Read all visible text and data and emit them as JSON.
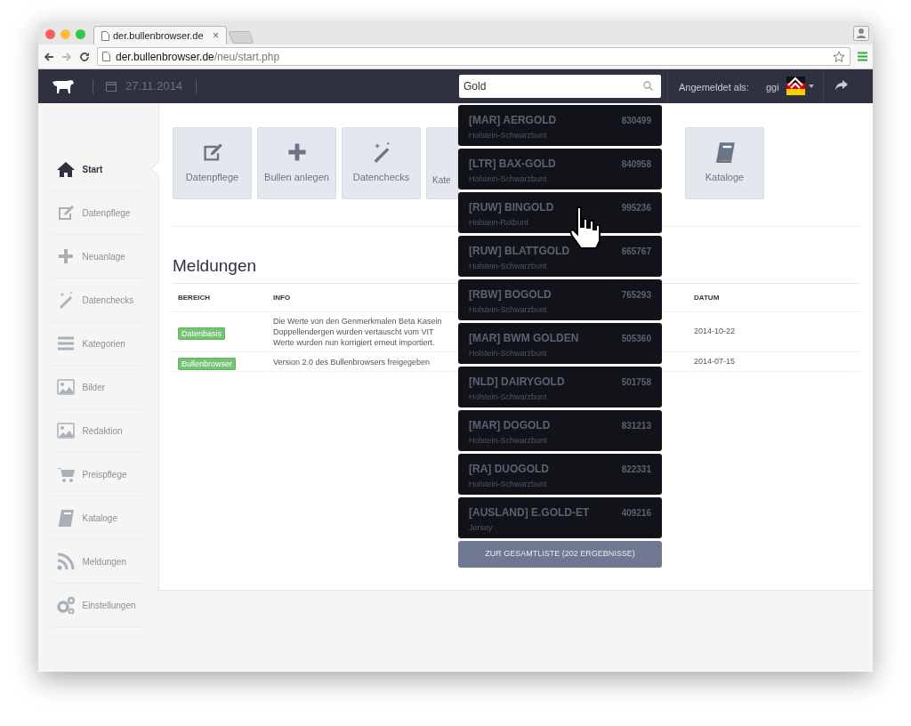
{
  "browser": {
    "tab_title": "der.bullenbrowser.de",
    "tab_close": "×",
    "url_host": "der.bullenbrowser.de",
    "url_path": "/neu/start.php"
  },
  "header": {
    "date": "27.11.2014",
    "search": {
      "value": "Gold"
    },
    "logged_in_label": "Angemeldet als:",
    "user": "ggi"
  },
  "sidebar": {
    "items": [
      {
        "label": "Start",
        "kind": "home",
        "selected": true
      },
      {
        "label": "Datenpflege",
        "kind": "edit",
        "selected": false
      },
      {
        "label": "Neuanlage",
        "kind": "plus",
        "selected": false
      },
      {
        "label": "Datenchecks",
        "kind": "wand",
        "selected": false
      },
      {
        "label": "Kategorien",
        "kind": "bars",
        "selected": false
      },
      {
        "label": "Bilder",
        "kind": "image",
        "selected": false
      },
      {
        "label": "Redaktion",
        "kind": "image",
        "selected": false
      },
      {
        "label": "Preispflege",
        "kind": "cart",
        "selected": false
      },
      {
        "label": "Kataloge",
        "kind": "book",
        "selected": false
      },
      {
        "label": "Meldungen",
        "kind": "rss",
        "selected": false
      },
      {
        "label": "Einstellungen",
        "kind": "gears",
        "selected": false
      }
    ]
  },
  "tiles": [
    {
      "label": "Datenpflege",
      "kind": "edit"
    },
    {
      "label": "Bullen anlegen",
      "kind": "plus"
    },
    {
      "label": "Datenchecks",
      "kind": "wand"
    },
    {
      "label": "Kate",
      "kind": "partial"
    },
    {
      "label": "Kataloge",
      "kind": "book"
    }
  ],
  "messages": {
    "title": "Meldungen",
    "columns": [
      "BEREICH",
      "INFO",
      "DATUM"
    ],
    "rows": [
      {
        "area": "Datenbasis",
        "info": "Die Werte von den Genmerkmalen Beta Kasein\nDoppellendergen wurden vertauscht vom VIT\nWerte wurden nun korrigiert erneut importiert.",
        "date": "2014-10-22"
      },
      {
        "area": "Bullenbrowser",
        "info": "Version 2.0 des Bullenbrowsers freigegeben",
        "date": "2014-07-15"
      }
    ]
  },
  "search_results": {
    "items": [
      {
        "name": "[MAR] AERGOLD",
        "number": "830499",
        "breed": "Holstein-Schwarzbunt"
      },
      {
        "name": "[LTR] BAX-GOLD",
        "number": "840958",
        "breed": "Holstein-Schwarzbunt"
      },
      {
        "name": "[RUW] BINGOLD",
        "number": "995236",
        "breed": "Holstein-Rotbunt"
      },
      {
        "name": "[RUW] BLATTGOLD",
        "number": "665767",
        "breed": "Holstein-Schwarzbunt"
      },
      {
        "name": "[RBW] BOGOLD",
        "number": "765293",
        "breed": "Holstein-Schwarzbunt"
      },
      {
        "name": "[MAR] BWM GOLDEN",
        "number": "505360",
        "breed": "Holstein-Schwarzbunt"
      },
      {
        "name": "[NLD] DAIRYGOLD",
        "number": "501758",
        "breed": "Holstein-Schwarzbunt"
      },
      {
        "name": "[MAR] DOGOLD",
        "number": "831213",
        "breed": "Holstein-Schwarzbunt"
      },
      {
        "name": "[RA] DUOGOLD",
        "number": "822331",
        "breed": "Holstein-Schwarzbunt"
      },
      {
        "name": "[AUSLAND] E.GOLD-ET",
        "number": "409216",
        "breed": "Jersey"
      }
    ],
    "all_results_button": "ZUR GESAMTLISTE (202 ERGEBNISSE)"
  }
}
